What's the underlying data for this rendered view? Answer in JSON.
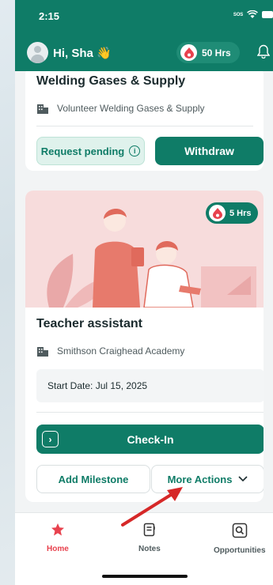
{
  "status_bar": {
    "time": "2:15",
    "sos": "SOS"
  },
  "header": {
    "greeting": "Hi, Sha 👋",
    "total_hours": "50 Hrs"
  },
  "card_top": {
    "title": "Welding Gases & Supply",
    "org": "Volunteer Welding Gases & Supply",
    "pending_label": "Request pending",
    "withdraw_label": "Withdraw"
  },
  "card_main": {
    "hours": "5 Hrs",
    "title": "Teacher assistant",
    "org": "Smithson Craighead Academy",
    "start_date": "Start Date: Jul 15, 2025",
    "checkin_label": "Check-In",
    "milestone_label": "Add Milestone",
    "more_actions_label": "More Actions"
  },
  "nav": {
    "items": [
      {
        "label": "Home",
        "icon": "star-icon",
        "active": true
      },
      {
        "label": "Notes",
        "icon": "notes-icon",
        "active": false
      },
      {
        "label": "Opportunities",
        "icon": "search-icon",
        "active": false
      }
    ]
  },
  "colors": {
    "primary": "#0f7c67",
    "accent": "#e8424e",
    "hero_bg": "#f7dcdc"
  }
}
